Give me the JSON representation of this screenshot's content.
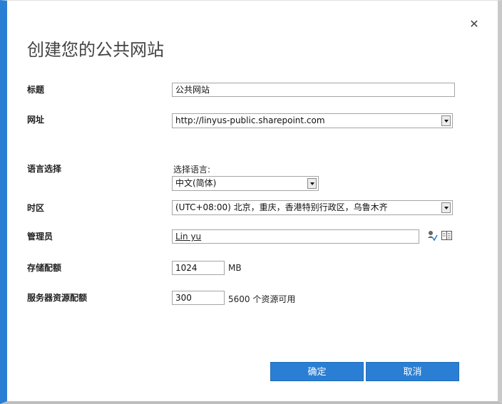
{
  "dialog": {
    "title": "创建您的公共网站",
    "close_label": "✕"
  },
  "fields": {
    "title": {
      "label": "标题",
      "value": "公共网站"
    },
    "url": {
      "label": "网址",
      "value": "http://linyus-public.sharepoint.com"
    },
    "language": {
      "label": "语言选择",
      "hint": "选择语言:",
      "value": "中文(简体)"
    },
    "timezone": {
      "label": "时区",
      "value": "(UTC+08:00) 北京，重庆，香港特别行政区，乌鲁木齐"
    },
    "admin": {
      "label": "管理员",
      "value": "Lin yu",
      "check_icon": "check-names-icon",
      "browse_icon": "address-book-icon"
    },
    "storage": {
      "label": "存储配额",
      "value": "1024",
      "unit": "MB"
    },
    "resource": {
      "label": "服务器资源配额",
      "value": "300",
      "hint": "5600 个资源可用"
    }
  },
  "buttons": {
    "ok": "确定",
    "cancel": "取消"
  },
  "colors": {
    "accent": "#2a7fd4",
    "button_text": "#ffffff"
  }
}
